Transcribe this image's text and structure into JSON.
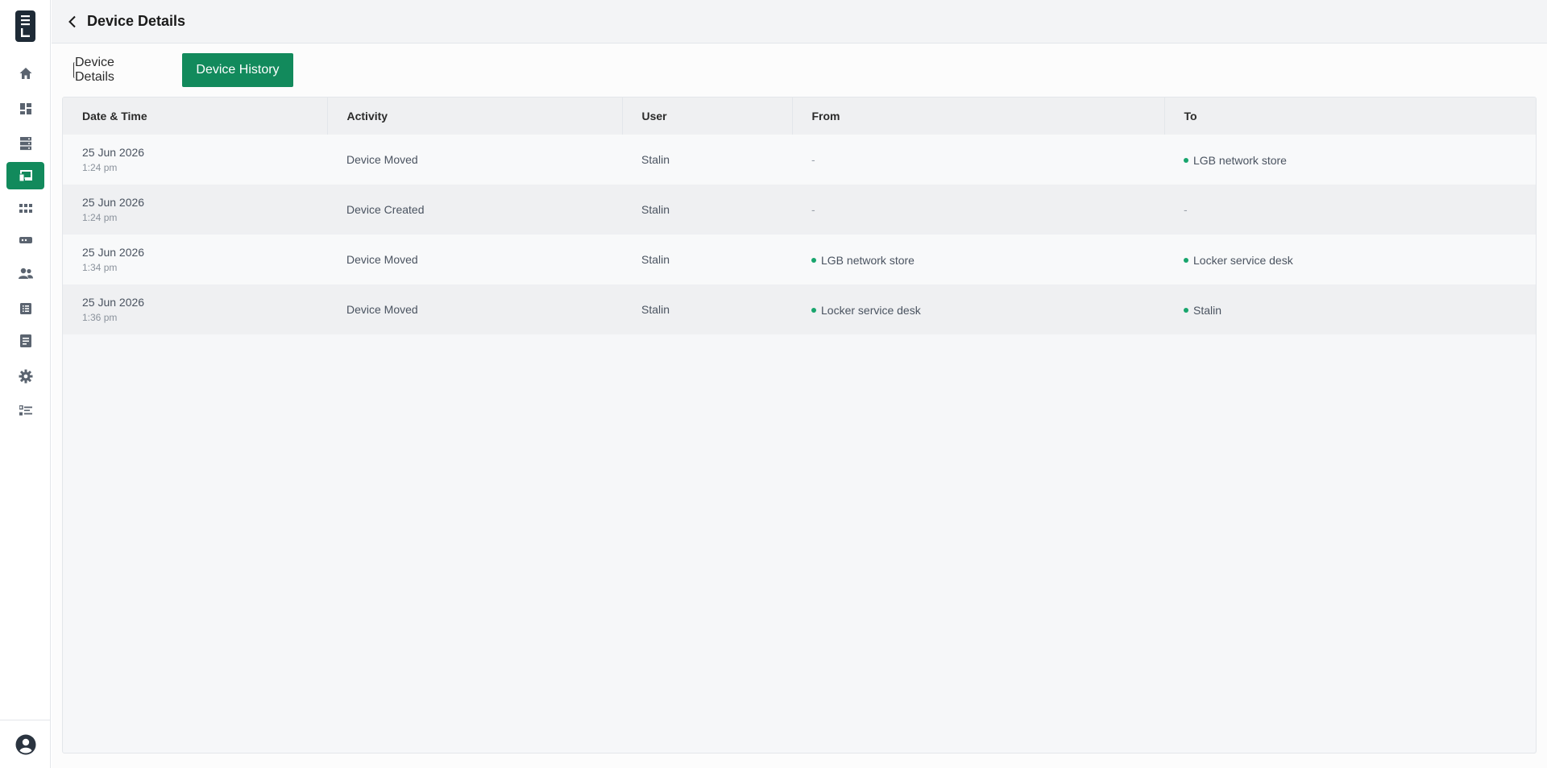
{
  "header": {
    "title": "Device Details"
  },
  "tabs": [
    {
      "label": "Device Details",
      "active": false
    },
    {
      "label": "Device History",
      "active": true
    }
  ],
  "sidebar": {
    "items": [
      {
        "icon": "home-icon"
      },
      {
        "icon": "dashboard-icon"
      },
      {
        "icon": "server-icon"
      },
      {
        "icon": "devices-icon",
        "active": true
      },
      {
        "icon": "grid-icon"
      },
      {
        "icon": "router-icon"
      },
      {
        "icon": "users-icon"
      },
      {
        "icon": "list-icon"
      },
      {
        "icon": "report-icon"
      },
      {
        "icon": "gear-icon"
      },
      {
        "icon": "checklist-icon"
      }
    ],
    "profile_icon": "account-icon"
  },
  "table": {
    "columns": [
      "Date & Time",
      "Activity",
      "User",
      "From",
      "To"
    ],
    "rows": [
      {
        "date": "25 Jun 2026",
        "time": "1:24 pm",
        "activity": "Device Moved",
        "user": "Stalin",
        "from": "-",
        "to": "LGB network store"
      },
      {
        "date": "25 Jun 2026",
        "time": "1:24 pm",
        "activity": "Device Created",
        "user": "Stalin",
        "from": "-",
        "to": "-"
      },
      {
        "date": "25 Jun 2026",
        "time": "1:34 pm",
        "activity": "Device Moved",
        "user": "Stalin",
        "from": "LGB network store",
        "to": "Locker service desk"
      },
      {
        "date": "25 Jun 2026",
        "time": "1:36 pm",
        "activity": "Device Moved",
        "user": "Stalin",
        "from": "Locker service desk",
        "to": "Stalin"
      }
    ]
  },
  "colors": {
    "accent": "#128a5c",
    "status_dot": "#18a56d"
  }
}
